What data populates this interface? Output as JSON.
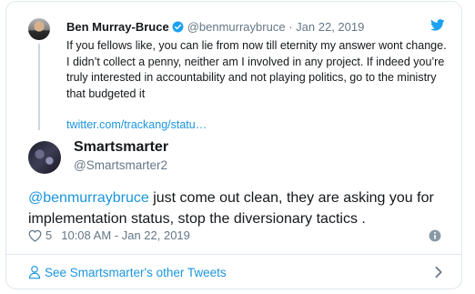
{
  "parent_tweet": {
    "author_name": "Ben Murray-Bruce",
    "handle": "@benmurraybruce",
    "separator": "·",
    "date": "Jan 22, 2019",
    "text": "If you fellows like, you can lie from now till eternity my answer wont change. I didn’t collect a penny, neither am I involved in any project. If indeed you’re truly interested in accountability and not playing politics, go to the ministry that budgeted it",
    "link": "twitter.com/trackang/statu…"
  },
  "tweet": {
    "author_name": "Smartsmarter",
    "handle": "@Smartsmarter2",
    "mention": "@benmurraybruce",
    "text": " just come out clean, they are asking you for implementation status, stop the diversionary tactics .",
    "likes": "5",
    "timestamp": "10:08 AM - Jan 22, 2019"
  },
  "footer": {
    "label": "See Smartsmarter's other Tweets"
  },
  "icons": {
    "verified": "verified-badge-icon",
    "bird": "twitter-bird-icon",
    "heart": "heart-icon",
    "info": "info-icon",
    "person": "person-icon",
    "chevron": "chevron-right-icon"
  },
  "colors": {
    "link_blue": "#1b95e0",
    "twitter_blue": "#1da1f2",
    "muted_gray": "#657786",
    "border": "#e1e8ed",
    "text": "#14171a"
  }
}
